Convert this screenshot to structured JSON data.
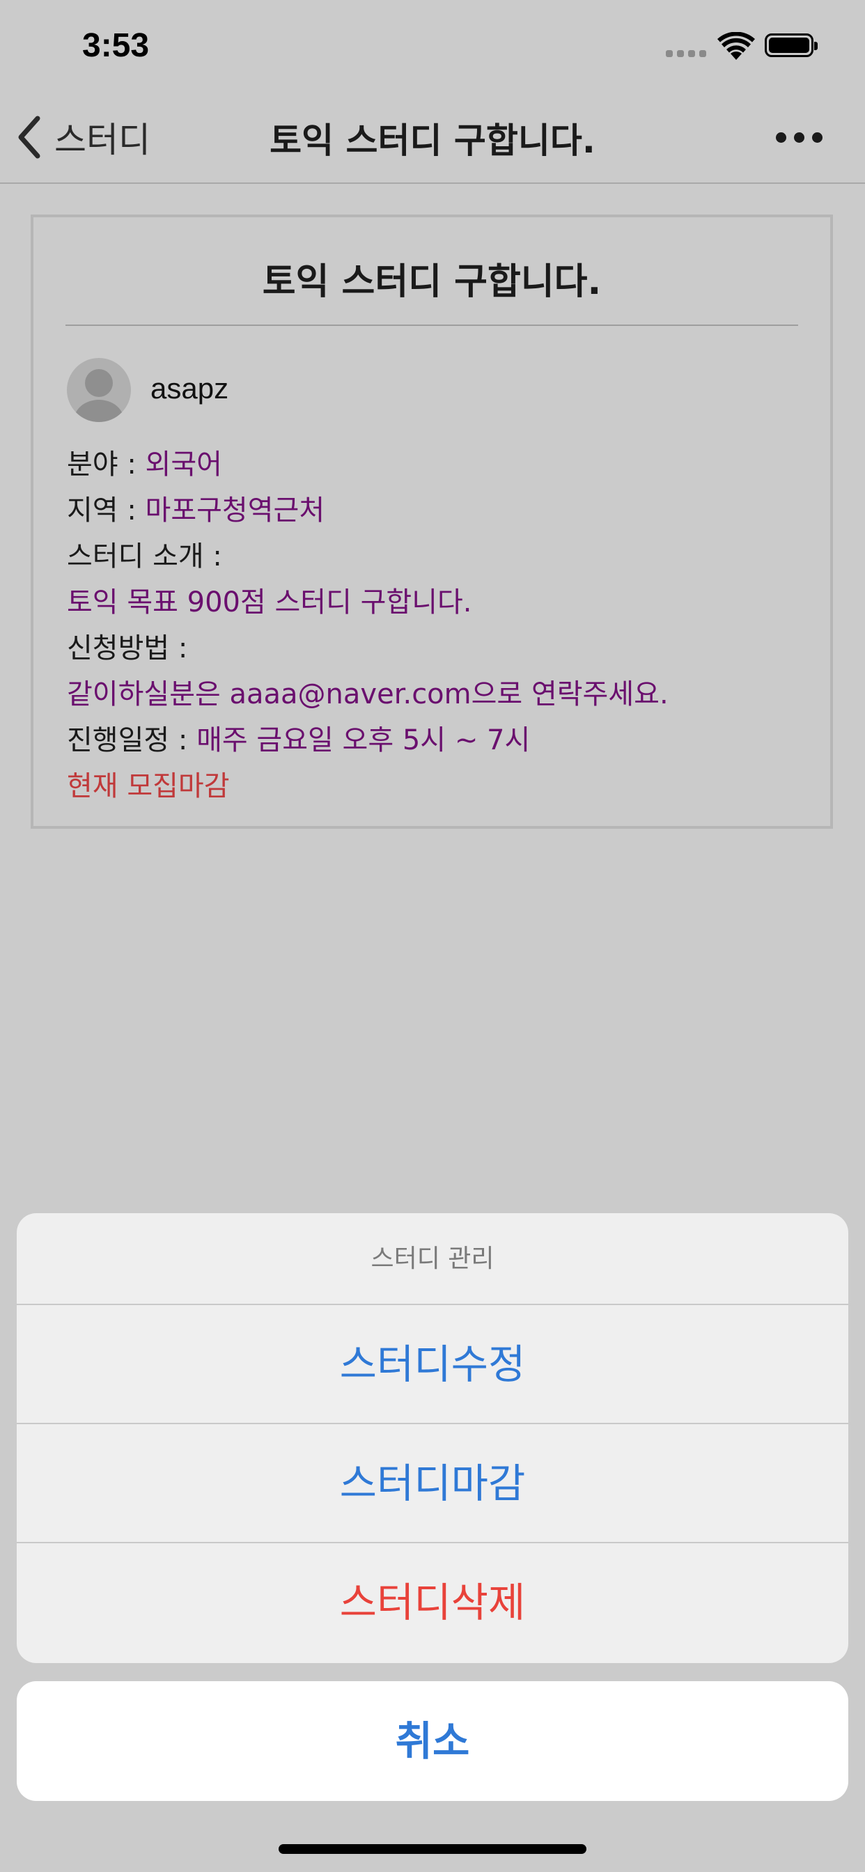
{
  "status_bar": {
    "time": "3:53"
  },
  "nav": {
    "back_label": "스터디",
    "title": "토익 스터디 구합니다."
  },
  "post": {
    "title": "토익 스터디 구합니다.",
    "author": "asapz",
    "field_label": "분야 : ",
    "field_value": "외국어",
    "region_label": "지역 : ",
    "region_value": "마포구청역근처",
    "intro_label": "스터디 소개 :",
    "intro_value": "토익 목표 900점 스터디 구합니다.",
    "apply_label": "신청방법 :",
    "apply_value": "같이하실분은 aaaa@naver.com으로 연락주세요.",
    "schedule_label": "진행일정 : ",
    "schedule_value": "매주 금요일 오후 5시 ~ 7시",
    "status": "현재 모집마감"
  },
  "action_sheet": {
    "title": "스터디 관리",
    "edit": "스터디수정",
    "close": "스터디마감",
    "delete": "스터디삭제",
    "cancel": "취소"
  },
  "colors": {
    "accent": "#2f79d6",
    "destructive": "#e8423a",
    "value_text": "#6a0f6e",
    "closed_text": "#c0393a"
  }
}
